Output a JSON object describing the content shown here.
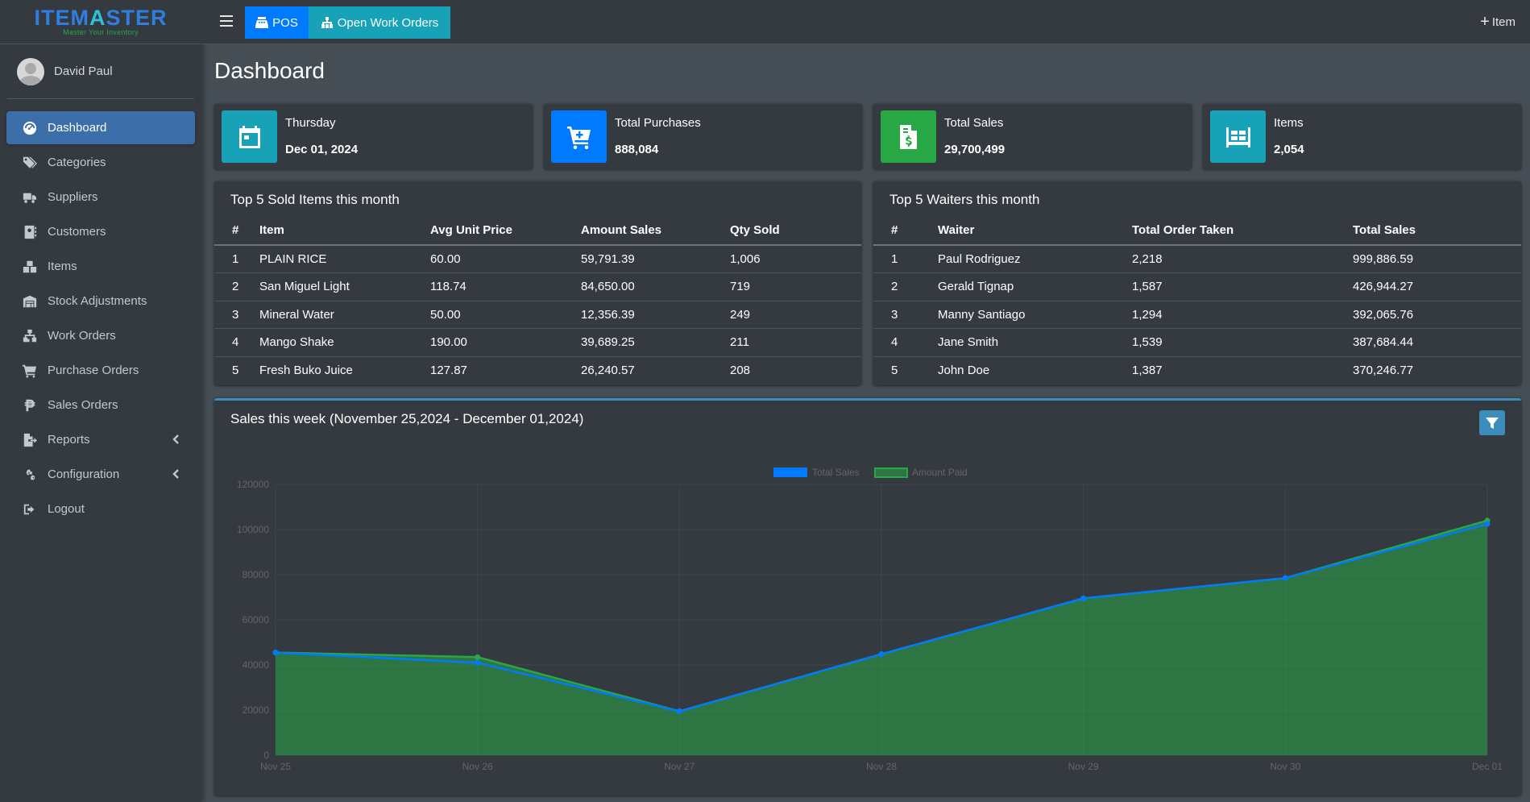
{
  "brand": {
    "name_part1": "ITEM",
    "name_part2": "A",
    "name_part3": "STER",
    "tagline": "Master Your Inventory"
  },
  "user": {
    "name": "David Paul"
  },
  "sidebar": {
    "items": [
      {
        "label": "Dashboard",
        "icon": "dashboard-icon",
        "active": true
      },
      {
        "label": "Categories",
        "icon": "tags-icon"
      },
      {
        "label": "Suppliers",
        "icon": "truck-icon"
      },
      {
        "label": "Customers",
        "icon": "address-book-icon"
      },
      {
        "label": "Items",
        "icon": "boxes-icon"
      },
      {
        "label": "Stock Adjustments",
        "icon": "warehouse-icon"
      },
      {
        "label": "Work Orders",
        "icon": "sitemap-icon"
      },
      {
        "label": "Purchase Orders",
        "icon": "cart-icon"
      },
      {
        "label": "Sales Orders",
        "icon": "peso-icon"
      },
      {
        "label": "Reports",
        "icon": "file-export-icon",
        "expandable": true
      },
      {
        "label": "Configuration",
        "icon": "cogs-icon",
        "expandable": true
      },
      {
        "label": "Logout",
        "icon": "sign-out-icon"
      }
    ]
  },
  "topbar": {
    "pos_label": "POS",
    "work_orders_label": "Open Work Orders",
    "add_item_label": "Item"
  },
  "page": {
    "title": "Dashboard"
  },
  "info_boxes": [
    {
      "label": "Thursday",
      "value": "Dec 01, 2024",
      "color": "#17a2b8",
      "icon": "calendar-icon"
    },
    {
      "label": "Total Purchases",
      "value": "888,084",
      "color": "#007bff",
      "icon": "cart-plus-icon"
    },
    {
      "label": "Total Sales",
      "value": "29,700,499",
      "color": "#28a745",
      "icon": "invoice-dollar-icon"
    },
    {
      "label": "Items",
      "value": "2,054",
      "color": "#17a2b8",
      "icon": "pallet-icon"
    }
  ],
  "top_items": {
    "title": "Top 5 Sold Items this month",
    "headers": [
      "#",
      "Item",
      "Avg Unit Price",
      "Amount Sales",
      "Qty Sold"
    ],
    "rows": [
      [
        "1",
        "PLAIN RICE",
        "60.00",
        "59,791.39",
        "1,006"
      ],
      [
        "2",
        "San Miguel Light",
        "118.74",
        "84,650.00",
        "719"
      ],
      [
        "3",
        "Mineral Water",
        "50.00",
        "12,356.39",
        "249"
      ],
      [
        "4",
        "Mango Shake",
        "190.00",
        "39,689.25",
        "211"
      ],
      [
        "5",
        "Fresh Buko Juice",
        "127.87",
        "26,240.57",
        "208"
      ]
    ]
  },
  "top_waiters": {
    "title": "Top 5 Waiters this month",
    "headers": [
      "#",
      "Waiter",
      "Total Order Taken",
      "Total Sales"
    ],
    "rows": [
      [
        "1",
        "Paul Rodriguez",
        "2,218",
        "999,886.59"
      ],
      [
        "2",
        "Gerald Tignap",
        "1,587",
        "426,944.27"
      ],
      [
        "3",
        "Manny Santiago",
        "1,294",
        "392,065.76"
      ],
      [
        "4",
        "Jane Smith",
        "1,539",
        "387,684.44"
      ],
      [
        "5",
        "John Doe",
        "1,387",
        "370,246.77"
      ]
    ]
  },
  "sales_chart": {
    "title": "Sales this week (November 25,2024 - December 01,2024)"
  },
  "chart_data": {
    "type": "area",
    "categories": [
      "Nov 25",
      "Nov 26",
      "Nov 27",
      "Nov 28",
      "Nov 29",
      "Nov 30",
      "Dec 01"
    ],
    "series": [
      {
        "name": "Total Sales",
        "values": [
          45500,
          41000,
          19500,
          44800,
          69500,
          78500,
          102500
        ],
        "color": "#007bff"
      },
      {
        "name": "Amount Paid",
        "values": [
          45500,
          43500,
          19500,
          44800,
          69500,
          78500,
          104000
        ],
        "color": "#28a745"
      }
    ],
    "y_ticks": [
      0,
      20000,
      40000,
      60000,
      80000,
      100000,
      120000
    ],
    "ylim": [
      0,
      120000
    ],
    "grid": true,
    "legend_position": "top-center"
  }
}
